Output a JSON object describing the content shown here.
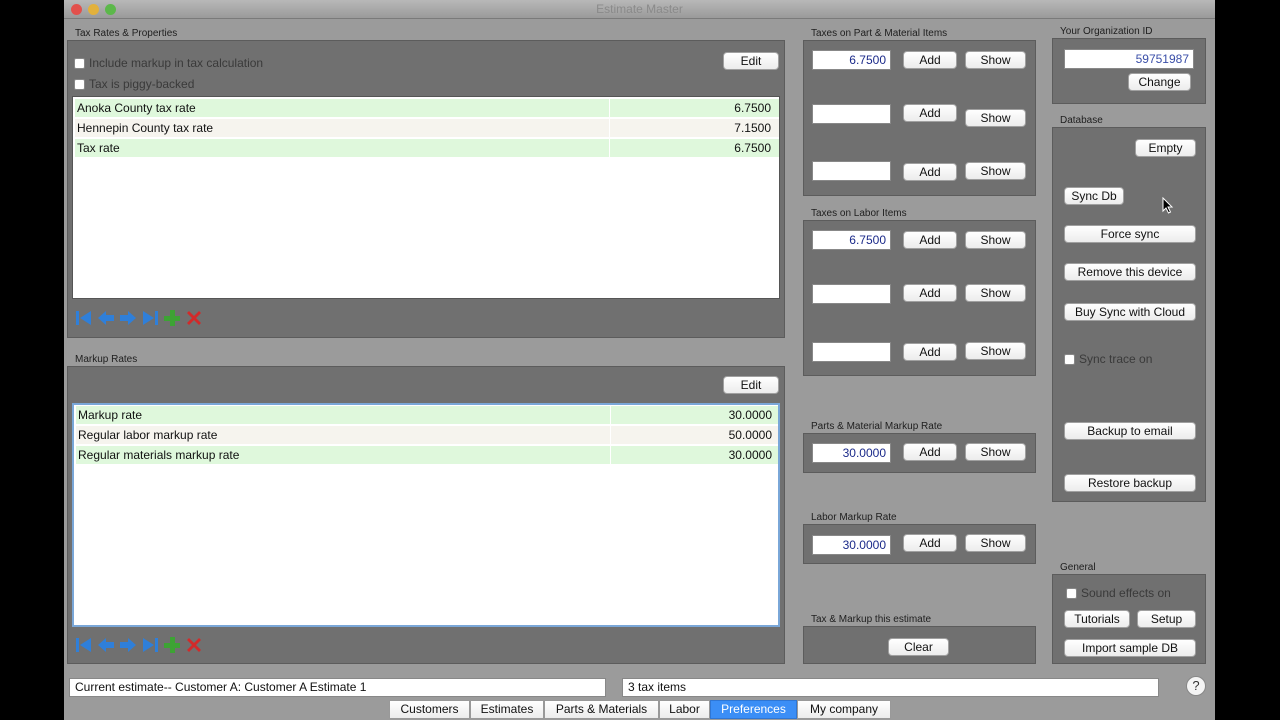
{
  "window": {
    "title": "Estimate Master"
  },
  "tax_rates": {
    "section_label": "Tax Rates & Properties",
    "include_markup_label": "Include markup in tax calculation",
    "piggy_backed_label": "Tax is piggy-backed",
    "edit_label": "Edit",
    "rows": [
      {
        "name": "Anoka County tax rate",
        "value": "6.7500"
      },
      {
        "name": "Hennepin County tax rate",
        "value": "7.1500"
      },
      {
        "name": "Tax rate",
        "value": "6.7500"
      }
    ]
  },
  "markup_rates": {
    "section_label": "Markup Rates",
    "edit_label": "Edit",
    "rows": [
      {
        "name": "Markup rate",
        "value": "30.0000"
      },
      {
        "name": "Regular labor markup rate",
        "value": "50.0000"
      },
      {
        "name": "Regular materials markup rate",
        "value": "30.0000"
      }
    ]
  },
  "taxes_parts": {
    "section_label": "Taxes on Part & Material Items",
    "values": [
      "6.7500",
      "",
      ""
    ],
    "add_label": "Add",
    "show_label": "Show"
  },
  "taxes_labor": {
    "section_label": "Taxes on Labor Items",
    "values": [
      "6.7500",
      "",
      ""
    ],
    "add_label": "Add",
    "show_label": "Show"
  },
  "parts_markup": {
    "section_label": "Parts & Material Markup Rate",
    "value": "30.0000",
    "add_label": "Add",
    "show_label": "Show"
  },
  "labor_markup": {
    "section_label": "Labor Markup Rate",
    "value": "30.0000",
    "add_label": "Add",
    "show_label": "Show"
  },
  "estimate_tax": {
    "section_label": "Tax & Markup this estimate",
    "clear_label": "Clear"
  },
  "org": {
    "section_label": "Your Organization ID",
    "id_value": "59751987",
    "change_label": "Change"
  },
  "database": {
    "section_label": "Database",
    "empty_label": "Empty",
    "sync_db_label": "Sync Db",
    "force_sync_label": "Force sync",
    "remove_device_label": "Remove this device",
    "buy_sync_label": "Buy Sync with Cloud",
    "sync_trace_label": "Sync trace on",
    "backup_email_label": "Backup to email",
    "restore_label": "Restore backup"
  },
  "general": {
    "section_label": "General",
    "sound_effects_label": "Sound effects on",
    "tutorials_label": "Tutorials",
    "setup_label": "Setup",
    "import_label": "Import sample DB"
  },
  "status": {
    "current_estimate": "Current estimate--  Customer A: Customer A Estimate 1",
    "tax_items": "3 tax items",
    "help_glyph": "?"
  },
  "tabs": [
    "Customers",
    "Estimates",
    "Parts & Materials",
    "Labor",
    "Preferences",
    "My company"
  ],
  "active_tab": "Preferences",
  "colors": {
    "window_bg": "#9b9b9b",
    "panel_bg": "#707070",
    "row_green": "#dff8dc",
    "row_cream": "#f6f4ee",
    "field_text": "#1b2a8a",
    "tab_active": "#3b8ef6"
  }
}
